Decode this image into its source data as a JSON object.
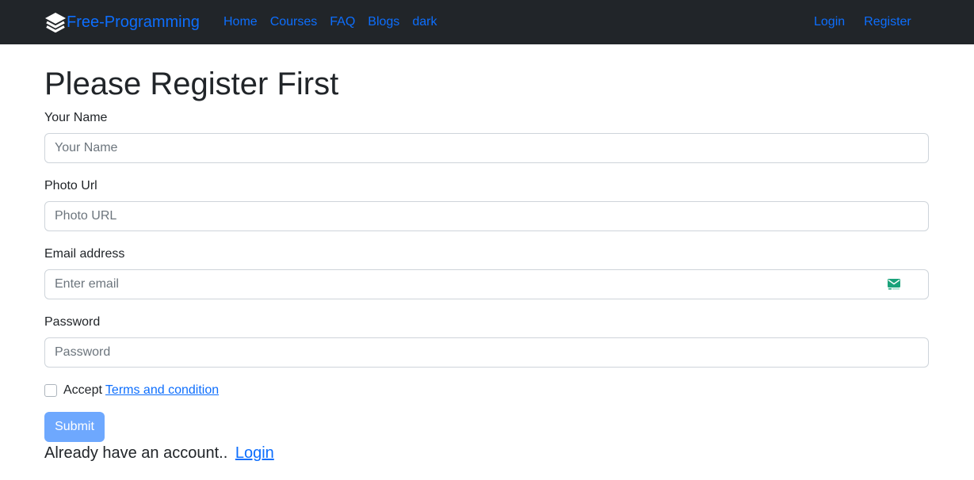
{
  "navbar": {
    "brand_icon": "layers-icon",
    "brand_text": "Free-Programming",
    "links": [
      "Home",
      "Courses",
      "FAQ",
      "Blogs",
      "dark"
    ],
    "right_links": [
      "Login",
      "Register"
    ]
  },
  "page": {
    "title": "Please Register First"
  },
  "form": {
    "name_label": "Your Name",
    "name_placeholder": "Your Name",
    "name_value": "",
    "photo_label": "Photo Url",
    "photo_placeholder": "Photo URL",
    "photo_value": "",
    "email_label": "Email address",
    "email_placeholder": "Enter email",
    "email_value": "",
    "email_icon": "mail-autofill-icon",
    "password_label": "Password",
    "password_placeholder": "Password",
    "password_value": "",
    "accept_text": "Accept",
    "terms_link": "Terms and condition",
    "terms_checked": false,
    "submit_label": "Submit"
  },
  "footer": {
    "text": "Already have an account..",
    "login_link": "Login"
  },
  "colors": {
    "navbar_bg": "#212529",
    "link": "#0d6efd",
    "submit_bg": "#6ea8fe",
    "input_border": "#ced4da"
  }
}
